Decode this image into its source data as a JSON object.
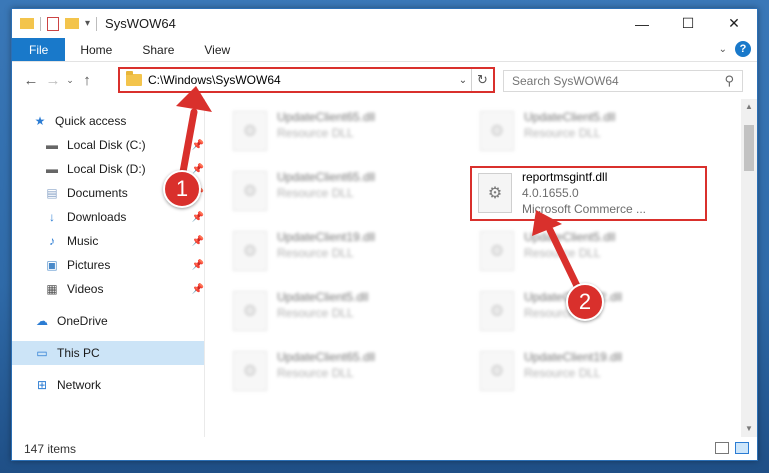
{
  "window": {
    "title": "SysWOW64",
    "controls": {
      "minimize": "—",
      "maximize": "☐",
      "close": "✕"
    }
  },
  "ribbon": {
    "tabs": [
      "File",
      "Home",
      "Share",
      "View"
    ],
    "help_icon": "?"
  },
  "address_bar": {
    "path": "C:\\Windows\\SysWOW64",
    "search_placeholder": "Search SysWOW64"
  },
  "nav_pane": {
    "items": [
      {
        "label": "Quick access",
        "icon": "star-icon",
        "pinned": false
      },
      {
        "label": "Local Disk (C:)",
        "icon": "drive-icon",
        "pinned": true
      },
      {
        "label": "Local Disk (D:)",
        "icon": "drive-icon",
        "pinned": true
      },
      {
        "label": "Documents",
        "icon": "document-icon",
        "pinned": true
      },
      {
        "label": "Downloads",
        "icon": "download-icon",
        "pinned": true
      },
      {
        "label": "Music",
        "icon": "music-icon",
        "pinned": true
      },
      {
        "label": "Pictures",
        "icon": "pictures-icon",
        "pinned": true
      },
      {
        "label": "Videos",
        "icon": "videos-icon",
        "pinned": true
      },
      {
        "label": "OneDrive",
        "icon": "cloud-icon",
        "pinned": false
      },
      {
        "label": "This PC",
        "icon": "computer-icon",
        "pinned": false,
        "selected": true
      },
      {
        "label": "Network",
        "icon": "network-icon",
        "pinned": false
      }
    ]
  },
  "files": {
    "blurred": [
      {
        "name": "UpdateClient65.dll",
        "type": "Resource DLL"
      },
      {
        "name": "UpdateClient5.dll",
        "type": "Resource DLL"
      },
      {
        "name": "UpdateClient65.dll",
        "type": "Resource DLL"
      },
      {
        "name": "UpdateClient19.dll",
        "type": "Resource DLL"
      },
      {
        "name": "UpdateClient5.dll",
        "type": "Resource DLL"
      },
      {
        "name": "UpdateClient5.dll",
        "type": "Resource DLL"
      },
      {
        "name": "UpdateClient42.dll",
        "type": "Resource DLL"
      },
      {
        "name": "UpdateClient65.dll",
        "type": "Resource DLL"
      },
      {
        "name": "UpdateClient19.dll",
        "type": "Resource DLL"
      }
    ],
    "highlighted": {
      "name": "reportmsgintf.dll",
      "version": "4.0.1655.0",
      "company": "Microsoft Commerce ..."
    }
  },
  "status_bar": {
    "item_count": "147 items"
  },
  "callouts": [
    "1",
    "2"
  ],
  "colors": {
    "accent": "#1979ca",
    "highlight": "#d9302c"
  }
}
